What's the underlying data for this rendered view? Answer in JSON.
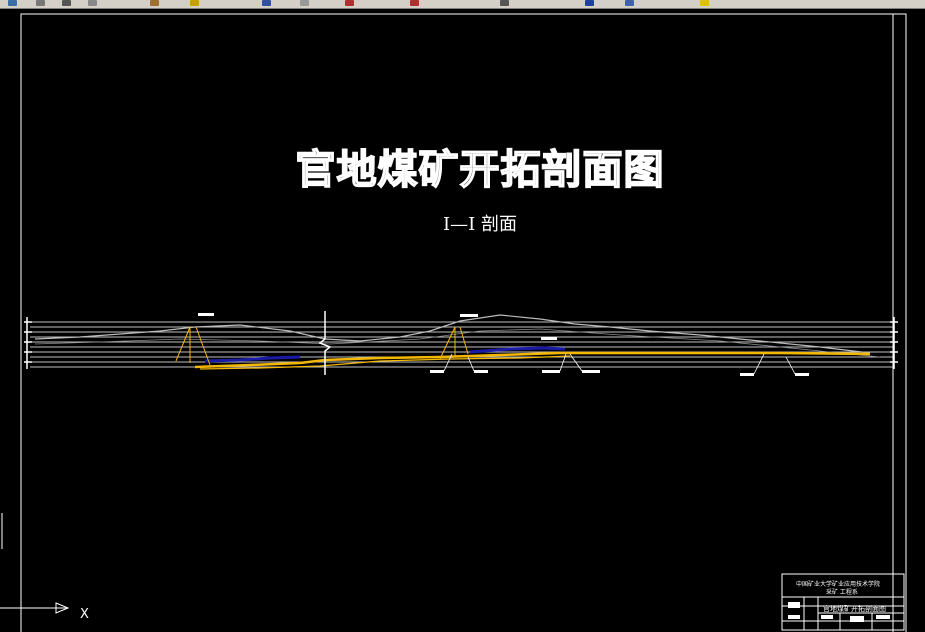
{
  "drawing": {
    "title": "官地煤矿开拓剖面图",
    "section_label": "I—I 剖面"
  },
  "title_block": {
    "institution": "中国矿业大学矿业应用技术学院",
    "department": "采矿 工程系",
    "drawing_name": "官地煤矿开拓剖面图"
  },
  "ucs": {
    "x_label": "X"
  },
  "colors": {
    "background": "#000000",
    "lines": "#ffffff",
    "seam": "#f5b800",
    "blue_seam": "#1a1aa8",
    "terrain": "#bbbbbb"
  },
  "toolbar_icons": [
    "save-icon",
    "print-icon",
    "cut-icon",
    "copy-icon",
    "paste-icon",
    "match-icon",
    "undo-icon",
    "redo-icon",
    "pan-icon",
    "zoom-icon",
    "properties-icon",
    "help-icon"
  ]
}
